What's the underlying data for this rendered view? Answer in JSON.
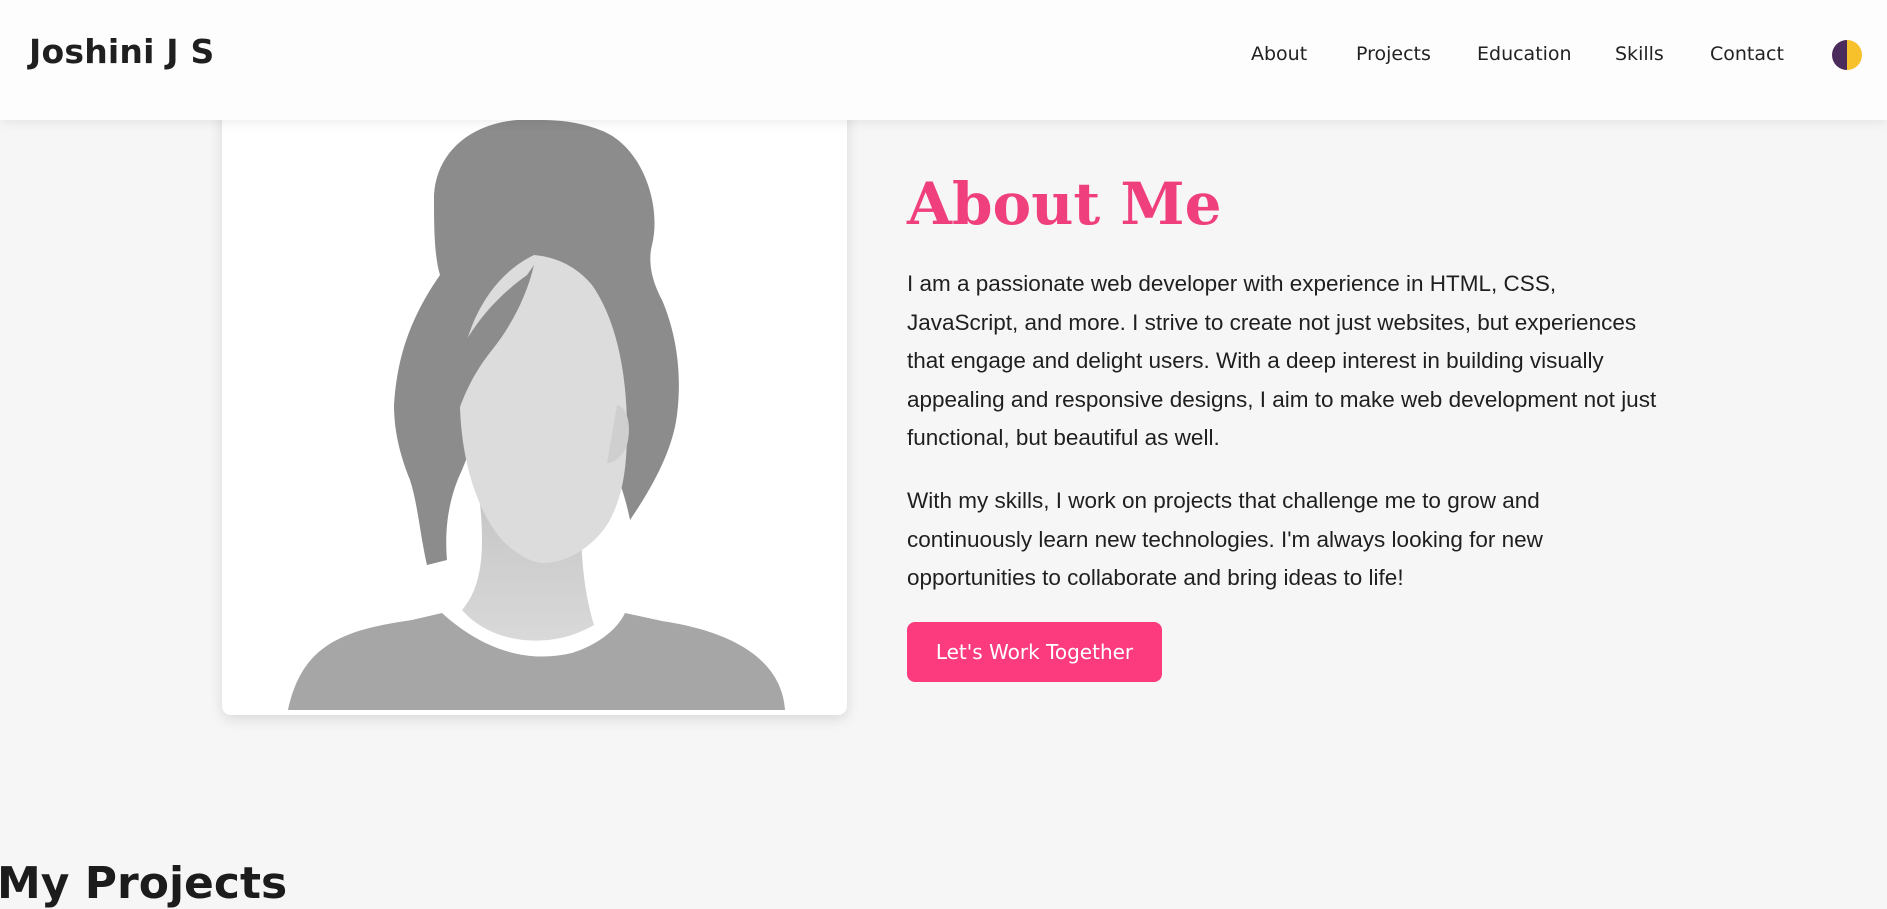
{
  "header": {
    "brand": "Joshini J S",
    "nav": [
      {
        "label": "About"
      },
      {
        "label": "Projects"
      },
      {
        "label": "Education"
      },
      {
        "label": "Skills"
      },
      {
        "label": "Contact"
      }
    ],
    "theme_toggle_icon": "half-moon-theme-icon"
  },
  "about": {
    "title": "About Me",
    "paragraph1": "I am a passionate web developer with experience in HTML, CSS, JavaScript, and more. I strive to create not just websites, but experiences that engage and delight users. With a deep interest in building visually appealing and responsive designs, I aim to make web development not just functional, but beautiful as well.",
    "paragraph2": "With my skills, I work on projects that challenge me to grow and continuously learn new technologies. I'm always looking for new opportunities to collaborate and bring ideas to life!",
    "cta_label": "Let's Work Together",
    "photo_icon": "avatar-placeholder-icon"
  },
  "projects": {
    "heading": "My Projects"
  },
  "colors": {
    "accent": "#fb3b7e",
    "title": "#ef3f7c",
    "background": "#f6f6f6",
    "toggle_dark": "#4b2a5c",
    "toggle_light": "#f6c12b"
  }
}
